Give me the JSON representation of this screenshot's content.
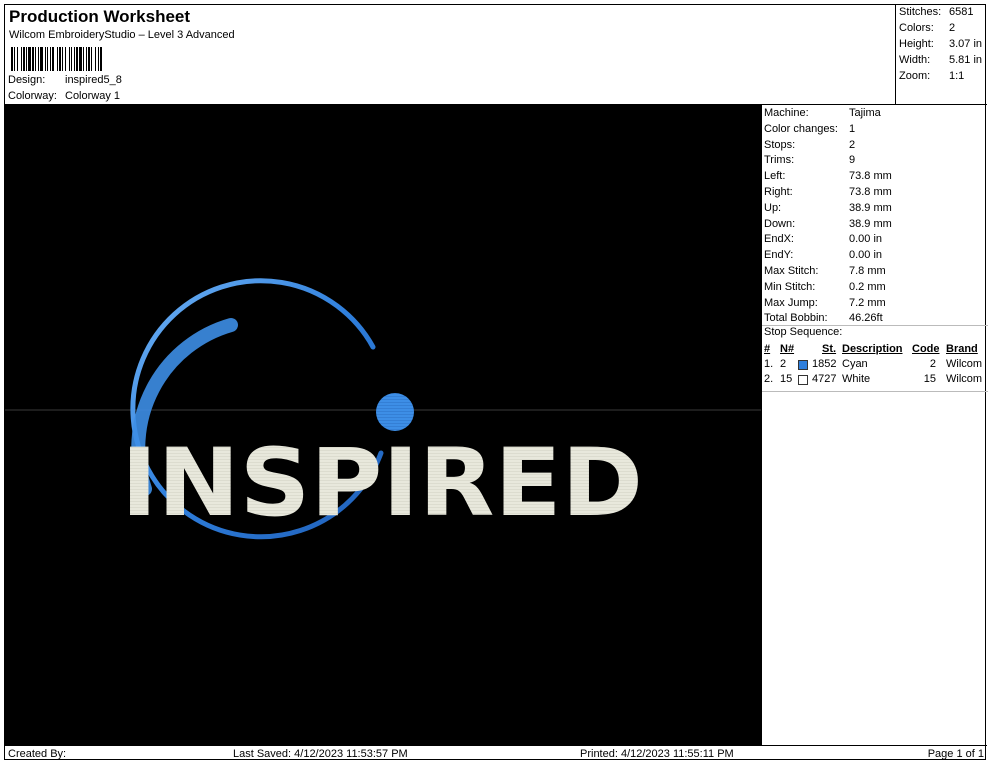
{
  "header": {
    "title": "Production Worksheet",
    "subtitle": "Wilcom EmbroideryStudio – Level 3 Advanced",
    "design_label": "Design:",
    "design_value": "inspired5_8",
    "colorway_label": "Colorway:",
    "colorway_value": "Colorway 1"
  },
  "summary": [
    {
      "label": "Stitches:",
      "value": "6581"
    },
    {
      "label": "Colors:",
      "value": "2"
    },
    {
      "label": "Height:",
      "value": "3.07 in"
    },
    {
      "label": "Width:",
      "value": "5.81 in"
    },
    {
      "label": "Zoom:",
      "value": "1:1"
    }
  ],
  "stats": [
    {
      "label": "Machine:",
      "value": "Tajima"
    },
    {
      "label": "Color changes:",
      "value": "1"
    },
    {
      "label": "Stops:",
      "value": "2"
    },
    {
      "label": "Trims:",
      "value": "9"
    },
    {
      "label": "Left:",
      "value": "73.8 mm"
    },
    {
      "label": "Right:",
      "value": "73.8 mm"
    },
    {
      "label": "Up:",
      "value": "38.9 mm"
    },
    {
      "label": "Down:",
      "value": "38.9 mm"
    },
    {
      "label": "EndX:",
      "value": "0.00 in"
    },
    {
      "label": "EndY:",
      "value": "0.00 in"
    },
    {
      "label": "Max Stitch:",
      "value": "7.8 mm"
    },
    {
      "label": "Min Stitch:",
      "value": "0.2 mm"
    },
    {
      "label": "Max Jump:",
      "value": "7.2 mm"
    },
    {
      "label": "Total Bobbin:",
      "value": "46.26ft"
    }
  ],
  "stop_sequence": {
    "label": "Stop Sequence:",
    "headers": {
      "num": "#",
      "n": "N#",
      "st": "St.",
      "description": "Description",
      "code": "Code",
      "brand": "Brand"
    },
    "rows": [
      {
        "num": "1.",
        "n": "2",
        "color": "#2f7fdc",
        "st": "1852",
        "description": "Cyan",
        "code": "2",
        "brand": "Wilcom"
      },
      {
        "num": "2.",
        "n": "15",
        "color": "#ffffff",
        "st": "4727",
        "description": "White",
        "code": "15",
        "brand": "Wilcom"
      }
    ]
  },
  "design": {
    "text": "INSPIRED",
    "text_color": "#e8e8dc",
    "accent_color": "#3d8ee6"
  },
  "footer": {
    "created_by": "Created By:",
    "last_saved": "Last Saved: 4/12/2023 11:53:57 PM",
    "printed": "Printed: 4/12/2023 11:55:11 PM",
    "page": "Page 1 of 1"
  }
}
